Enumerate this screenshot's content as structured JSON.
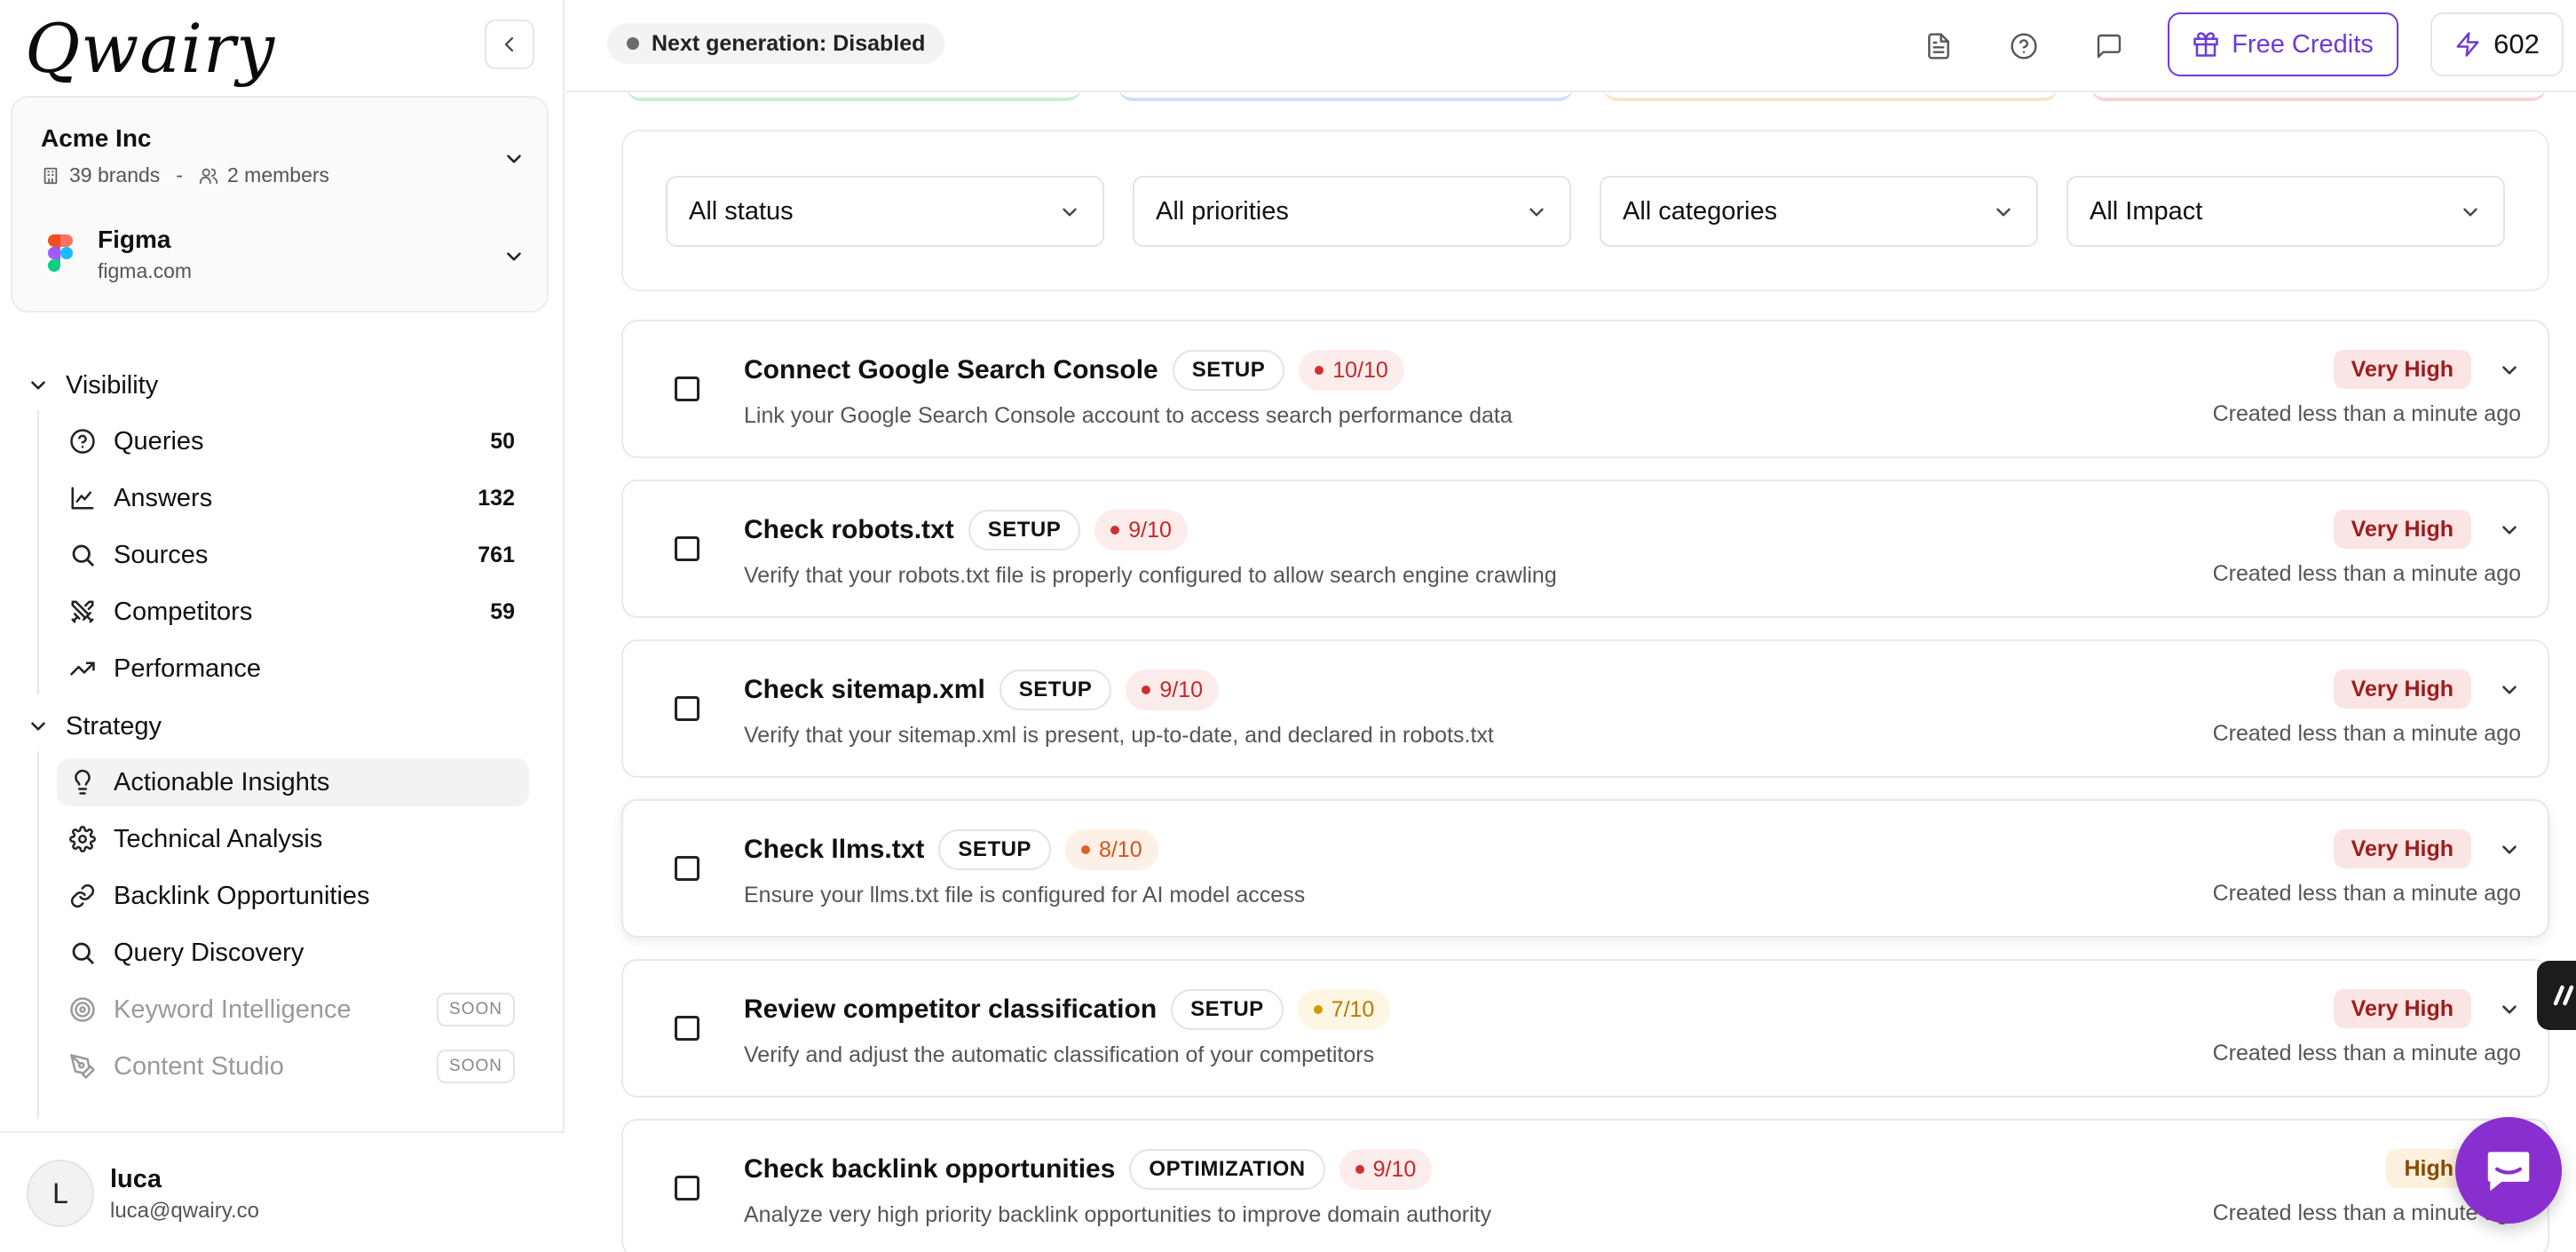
{
  "app": {
    "logo_text": "Qwairy"
  },
  "org": {
    "name": "Acme Inc",
    "brands": "39 brands",
    "separator": "-",
    "members": "2 members"
  },
  "brand": {
    "name": "Figma",
    "domain": "figma.com"
  },
  "nav": {
    "visibility": {
      "label": "Visibility",
      "items": [
        {
          "label": "Queries",
          "count": "50",
          "icon": "help-circle-icon"
        },
        {
          "label": "Answers",
          "count": "132",
          "icon": "line-chart-icon"
        },
        {
          "label": "Sources",
          "count": "761",
          "icon": "search-icon"
        },
        {
          "label": "Competitors",
          "count": "59",
          "icon": "swords-icon"
        },
        {
          "label": "Performance",
          "count": "",
          "icon": "trending-up-icon"
        }
      ]
    },
    "strategy": {
      "label": "Strategy",
      "items": [
        {
          "label": "Actionable Insights",
          "icon": "lightbulb-icon"
        },
        {
          "label": "Technical Analysis",
          "icon": "gear-icon"
        },
        {
          "label": "Backlink Opportunities",
          "icon": "link-icon"
        },
        {
          "label": "Query Discovery",
          "icon": "search-icon"
        },
        {
          "label": "Keyword Intelligence",
          "icon": "target-icon",
          "badge": "SOON"
        },
        {
          "label": "Content Studio",
          "icon": "pen-tool-icon",
          "badge": "SOON"
        }
      ]
    }
  },
  "user": {
    "initial": "L",
    "name": "luca",
    "email": "luca@qwairy.co"
  },
  "header": {
    "generation_status": "Next generation: Disabled",
    "free_credits_label": "Free Credits",
    "credits_count": "602"
  },
  "filters": {
    "status": "All status",
    "priorities": "All priorities",
    "categories": "All categories",
    "impact": "All Impact"
  },
  "insights": [
    {
      "title": "Connect Google Search Console",
      "tag": "SETUP",
      "score": "10/10",
      "score_level": "red",
      "description": "Link your Google Search Console account to access search performance data",
      "impact": "Very High",
      "created": "Created less than a minute ago"
    },
    {
      "title": "Check robots.txt",
      "tag": "SETUP",
      "score": "9/10",
      "score_level": "red",
      "description": "Verify that your robots.txt file is properly configured to allow search engine crawling",
      "impact": "Very High",
      "created": "Created less than a minute ago"
    },
    {
      "title": "Check sitemap.xml",
      "tag": "SETUP",
      "score": "9/10",
      "score_level": "red",
      "description": "Verify that your sitemap.xml is present, up-to-date, and declared in robots.txt",
      "impact": "Very High",
      "created": "Created less than a minute ago"
    },
    {
      "title": "Check llms.txt",
      "tag": "SETUP",
      "score": "8/10",
      "score_level": "orange",
      "description": "Ensure your llms.txt file is configured for AI model access",
      "impact": "Very High",
      "created": "Created less than a minute ago"
    },
    {
      "title": "Review competitor classification",
      "tag": "SETUP",
      "score": "7/10",
      "score_level": "yellow",
      "description": "Verify and adjust the automatic classification of your competitors",
      "impact": "Very High",
      "created": "Created less than a minute ago"
    },
    {
      "title": "Check backlink opportunities",
      "tag": "OPTIMIZATION",
      "score": "9/10",
      "score_level": "red",
      "description": "Analyze very high priority backlink opportunities to improve domain authority",
      "impact": "High",
      "created": "Created less than a minute ago"
    }
  ],
  "colors": {
    "accent": "#6d3bd6",
    "chat_fab": "#8a2fcf",
    "very_high_bg": "#fbe4e4",
    "high_bg": "#fdf0dc"
  }
}
